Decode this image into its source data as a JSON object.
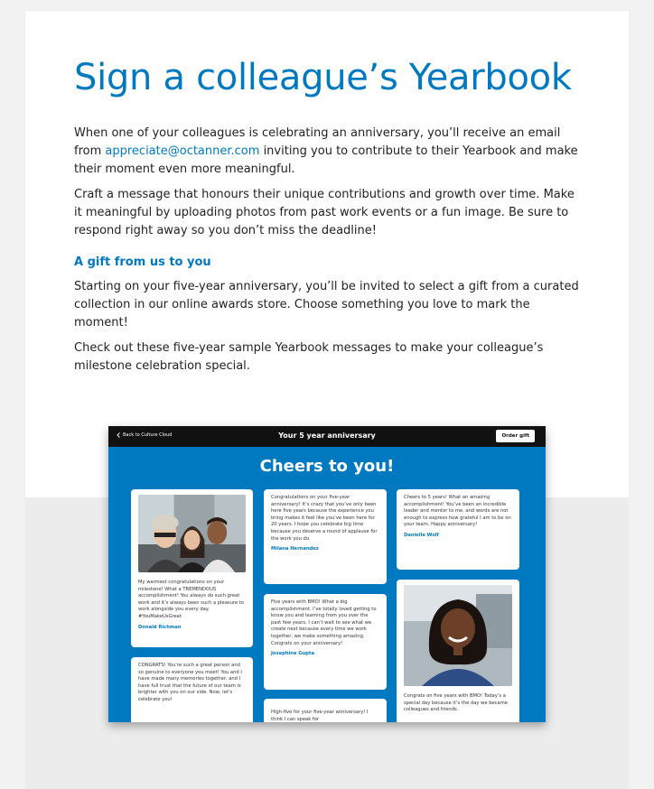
{
  "heading": "Sign a colleague’s Yearbook",
  "intro": {
    "before_link": "When one of your colleagues is celebrating an anniversary, you’ll receive an email from ",
    "link": "appreciate@octanner.com",
    "after_link": " inviting you to contribute to their Yearbook and make their moment even more meaningful."
  },
  "paragraph2": "Craft a message that honours their unique contributions and growth over time. Make it meaningful by uploading photos from past work events or a fun image. Be sure to respond right away so you don’t miss the deadline!",
  "gift": {
    "subheading": "A gift from us to you",
    "para1": "Starting on your five-year anniversary, you’ll be invited to select a gift from a curated collection in our online awards store. Choose something you love to mark the moment!",
    "para2": "Check out these five-year sample Yearbook messages to make your colleague’s milestone celebration special."
  },
  "mock": {
    "back_label": "Back to Culture Cloud",
    "title": "Your 5 year anniversary",
    "order_label": "Order gift",
    "cheers": "Cheers to you!",
    "cards": {
      "c1": {
        "text": "My warmest congratulations on your milestone! What a TREMENDOUS accomplishment! You always do such great work and it’s always been such a pleasure to work alongside you every day. #YouMakeUsGreat",
        "name": "Donald Richman"
      },
      "c2": {
        "text": "CONGRATS! You’re such a great person and so genuine to everyone you meet! You and I have made many memories together, and I have full trust that the future of our team is brighter with you on our side. Now, let’s celebrate you!",
        "name": ""
      },
      "c3": {
        "text": "Congratulations on your five-year anniversary! It’s crazy that you’ve only been here five years because the experience you bring makes it feel like you’ve been here for 20 years. I hope you celebrate big time because you deserve a round of applause for the work you do.",
        "name": "Milana Hernandez"
      },
      "c4": {
        "text": "Five years with BMO! What a big accomplishment. I’ve totally loved getting to know you and learning from you over the past few years. I can’t wait to see what we create next because every time we work together, we make something amazing. Congrats on your anniversary!",
        "name": "Josephine Gupta"
      },
      "c5": {
        "text": "High-five for your five-year anniversary! I think I can speak for",
        "name": ""
      },
      "c6": {
        "text": "Cheers to 5 years! What an amazing accomplishment! You’ve been an incredible leader and mentor to me, and words are not enough to express how grateful I am to be on your team. Happy anniversary!",
        "name": "Danielle Wolf"
      },
      "c7": {
        "text": "Congrats on five years with BMO! Today’s a special day because it’s the day we became colleagues and friends.",
        "name": ""
      }
    }
  },
  "colors": {
    "brand_blue": "#0079c1",
    "topbar": "#111111"
  },
  "icons": {
    "back": "chevron-left-icon"
  }
}
